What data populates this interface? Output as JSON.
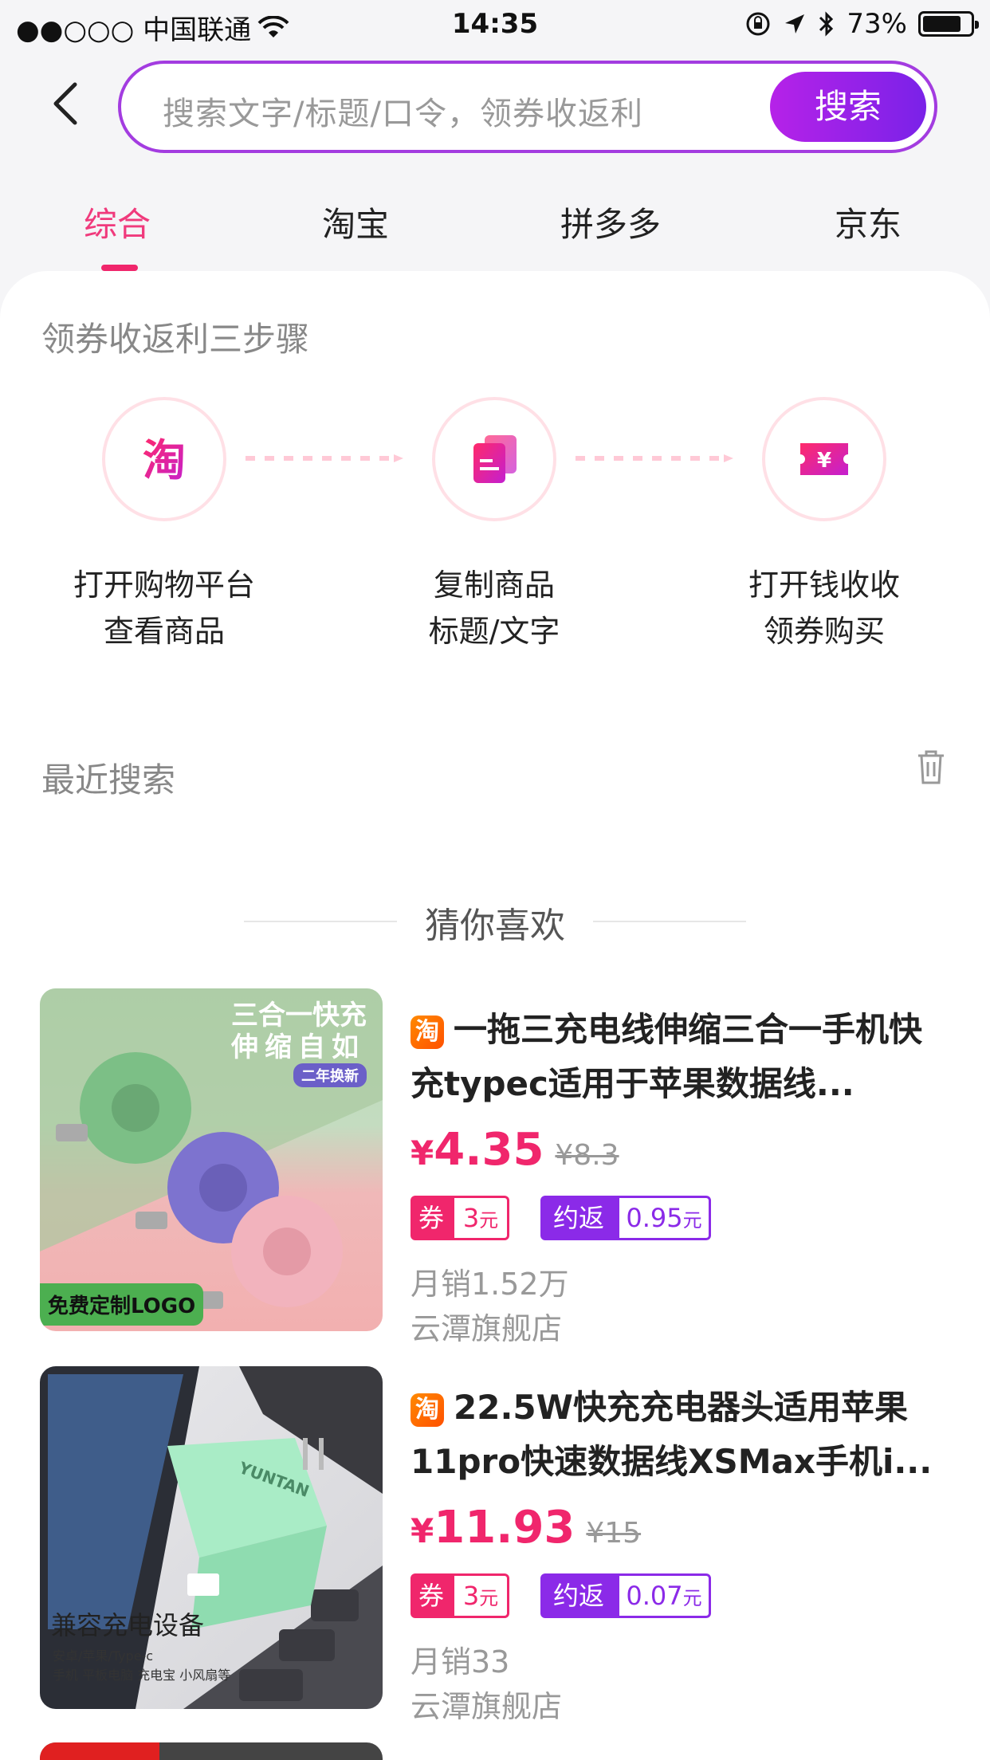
{
  "status": {
    "carrier": "●●○○○ 中国联通",
    "time": "14:35",
    "battery": "73%",
    "battery_level": 0.73
  },
  "search": {
    "placeholder": "搜索文字/标题/口令，领券收返利",
    "button": "搜索"
  },
  "tabs": [
    {
      "label": "综合",
      "active": true
    },
    {
      "label": "淘宝",
      "active": false
    },
    {
      "label": "拼多多",
      "active": false
    },
    {
      "label": "京东",
      "active": false
    }
  ],
  "steps": {
    "title": "领券收返利三步骤",
    "items": [
      {
        "line1": "打开购物平台",
        "line2": "查看商品",
        "icon": "taobao-icon"
      },
      {
        "line1": "复制商品",
        "line2": "标题/文字",
        "icon": "copy-icon"
      },
      {
        "line1": "打开钱收收",
        "line2": "领券购买",
        "icon": "coupon-yuan-icon"
      }
    ],
    "icon_glyphs": {
      "taobao": "淘",
      "yuan": "¥"
    }
  },
  "recent": {
    "title": "最近搜索"
  },
  "guess": {
    "title": "猜你喜欢"
  },
  "products": [
    {
      "platform_badge": "淘",
      "title": "一拖三充电线伸缩三合一手机快充typec适用于苹果数据线...",
      "price_symbol": "¥",
      "price": "4.35",
      "original_price": "¥8.3",
      "coupon_label": "券",
      "coupon_value": "3",
      "coupon_unit": "元",
      "rebate_label": "约返",
      "rebate_value": "0.95",
      "rebate_unit": "元",
      "sales": "月销1.52万",
      "shop": "云潭旗舰店",
      "image_text": {
        "line1": "三合一快充",
        "line2": "伸缩自如",
        "tag": "二年换新",
        "bottom": "免费定制LOGO"
      }
    },
    {
      "platform_badge": "淘",
      "title": "22.5W快充充电器头适用苹果11pro快速数据线XSMax手机i...",
      "price_symbol": "¥",
      "price": "11.93",
      "original_price": "¥15",
      "coupon_label": "券",
      "coupon_value": "3",
      "coupon_unit": "元",
      "rebate_label": "约返",
      "rebate_value": "0.07",
      "rebate_unit": "元",
      "sales": "月销33",
      "shop": "云潭旗舰店",
      "image_text": {
        "line1": "兼容充电设备",
        "line2": "安卓/苹果/Type-c",
        "line3": "手机 平板电脑 充电宝 小风扇等",
        "brand": "YUNTAN"
      }
    }
  ],
  "colors": {
    "accent": "#f0266c",
    "purple": "#8b2ae8",
    "search_border": "#a33ce0"
  }
}
